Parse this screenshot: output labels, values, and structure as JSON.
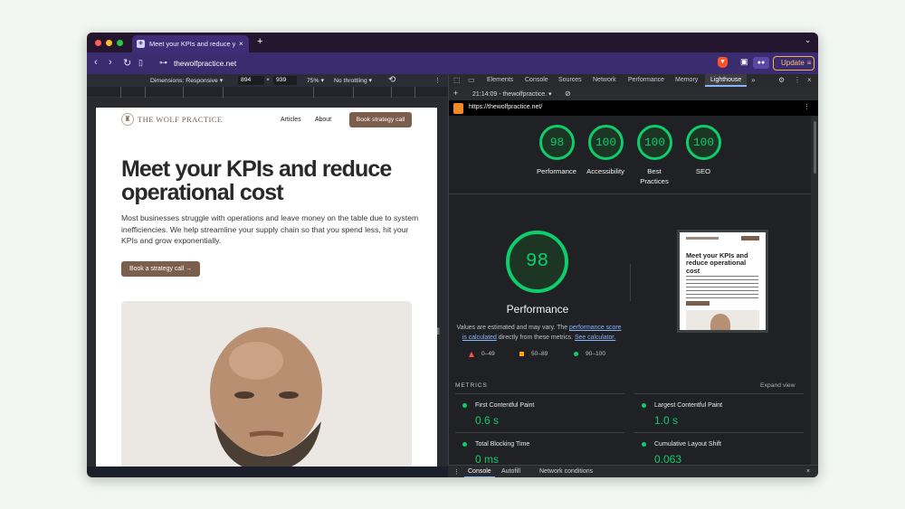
{
  "browser": {
    "tab_title": "Meet your KPIs and reduce y",
    "url": "thewolfpractice.net",
    "update_label": "Update"
  },
  "device_toolbar": {
    "dimensions_label": "Dimensions: Responsive",
    "width": "894",
    "times": "×",
    "height": "939",
    "zoom": "75%",
    "throttling": "No throttling"
  },
  "site": {
    "brand": "THE WOLF PRACTICE",
    "nav": [
      "Articles",
      "About"
    ],
    "cta": "Book strategy call",
    "headline": "Meet your KPIs and reduce operational cost",
    "subtext": "Most businesses struggle with operations and leave money on the table due to system inefficiencies. We help streamline your supply chain so that you spend less, hit your KPIs and grow exponentially.",
    "hero_button": "Book a strategy call"
  },
  "devtools": {
    "tabs": [
      "Elements",
      "Console",
      "Sources",
      "Network",
      "Performance",
      "Memory",
      "Lighthouse"
    ],
    "active_tab": "Lighthouse",
    "report_time": "21:14:09 - thewolfpractice.",
    "report_url": "https://thewolfpractice.net/",
    "drawer_tabs": [
      "Console",
      "Autofill",
      "Network conditions"
    ]
  },
  "lighthouse": {
    "scores": [
      {
        "label": "Performance",
        "value": "98"
      },
      {
        "label": "Accessibility",
        "value": "100"
      },
      {
        "label": "Best\nPractices",
        "value": "100"
      },
      {
        "label": "SEO",
        "value": "100"
      }
    ],
    "main_score": "98",
    "main_title": "Performance",
    "values_prefix": "Values are estimated and may vary. The ",
    "link1": "performance score is calculated",
    "values_mid": " directly from these metrics. ",
    "link2": "See calculator.",
    "legend": [
      "0–49",
      "50–89",
      "90–100"
    ],
    "metrics_heading": "METRICS",
    "expand_label": "Expand view",
    "metrics": [
      {
        "name": "First Contentful Paint",
        "value": "0.6 s"
      },
      {
        "name": "Largest Contentful Paint",
        "value": "1.0 s"
      },
      {
        "name": "Total Blocking Time",
        "value": "0 ms"
      },
      {
        "name": "Cumulative Layout Shift",
        "value": "0.063"
      }
    ],
    "thumbnail_title": "Meet your KPIs and reduce operational cost"
  },
  "colors": {
    "pass": "#0cce6b",
    "average": "#ffa400",
    "fail": "#ff4e42",
    "brand_brown": "#7b5e4c",
    "tab_purple": "#3f2d78"
  }
}
